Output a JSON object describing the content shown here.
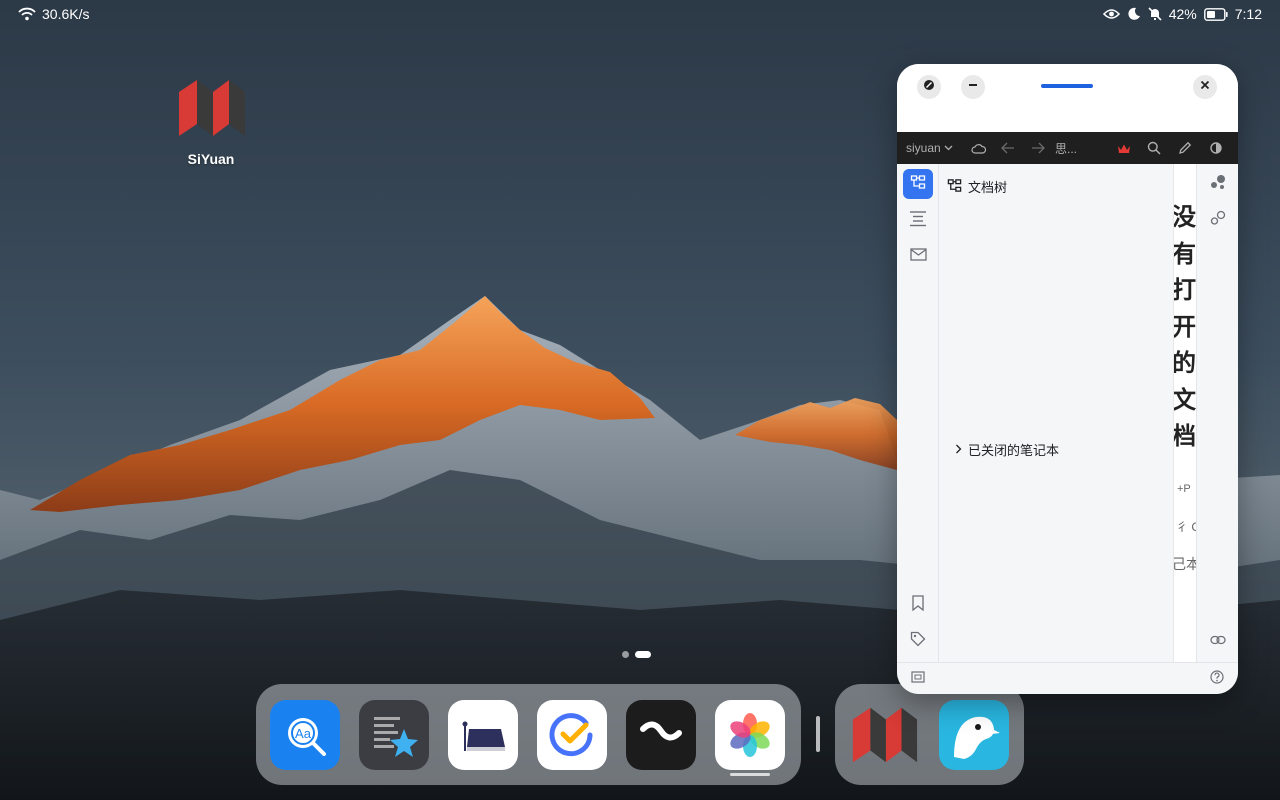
{
  "status_bar": {
    "network_speed": "30.6K/s",
    "battery_percent": "42%",
    "time": "7:12",
    "icons": [
      "wifi-icon",
      "eye-icon",
      "moon-icon",
      "bell-off-icon",
      "battery-icon"
    ]
  },
  "desktop": {
    "apps": [
      {
        "label": "SiYuan",
        "icon": "siyuan-logo-icon"
      }
    ],
    "page_count": 2,
    "current_page": 2
  },
  "dock": {
    "apps": [
      {
        "icon": "dictionary-icon",
        "color": "#1a82f0"
      },
      {
        "icon": "notes-star-icon",
        "color": "#3c3d42"
      },
      {
        "icon": "reader-icon",
        "color": "#ffffff"
      },
      {
        "icon": "ticktick-icon",
        "color": "#ffffff"
      },
      {
        "icon": "wave-app-icon",
        "color": "#1c1c1c"
      },
      {
        "icon": "gallery-flower-icon",
        "color": "#ffffff"
      }
    ],
    "recent_apps": [
      {
        "icon": "siyuan-logo-icon",
        "color": "#3a3a3a"
      },
      {
        "icon": "kiwi-browser-icon",
        "color": "#29b6e0"
      }
    ]
  },
  "window": {
    "toolbar": {
      "workspace": "siyuan",
      "breadcrumb": "思..."
    },
    "file_tree": {
      "title": "文档树",
      "closed_notebooks": "已关闭的笔记本"
    },
    "editor": {
      "empty_title": "没有打开的文档",
      "hints": [
        "+P",
        "彳 C",
        "己本"
      ]
    },
    "colors": {
      "accent": "#3574f0",
      "toolbar_bg": "#1f1f1f",
      "crown": "#e53935"
    }
  }
}
